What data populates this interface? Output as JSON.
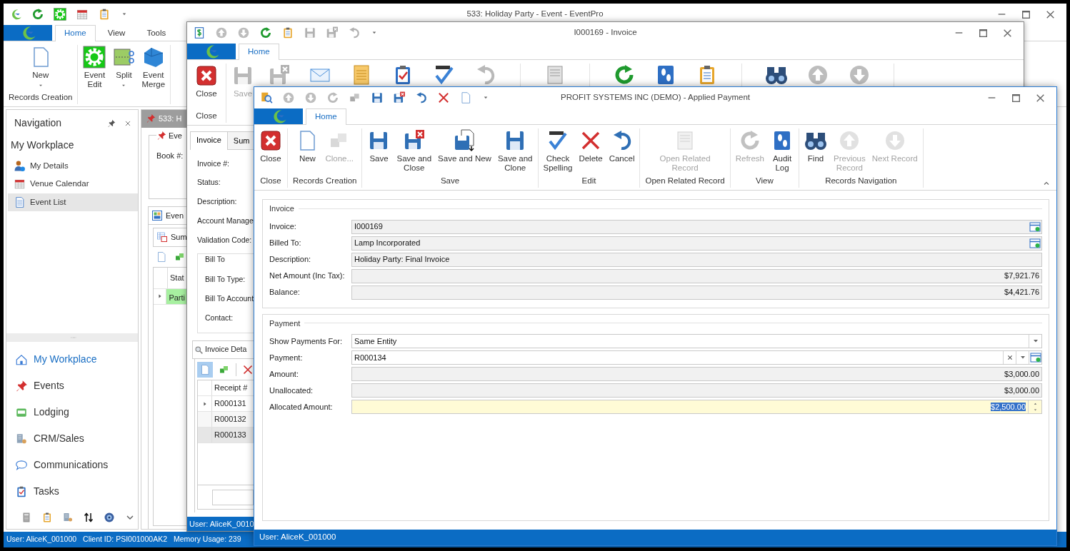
{
  "main_window": {
    "title": "533: Holiday Party - Event - EventPro",
    "tabs": [
      {
        "label": "Home",
        "selected": true
      },
      {
        "label": "View",
        "selected": false
      },
      {
        "label": "Tools",
        "selected": false
      }
    ],
    "ribbon_groups": [
      {
        "label": "Records Creation",
        "buttons": [
          {
            "kind": "new",
            "label": "New",
            "dropdown": true
          }
        ]
      },
      {
        "buttons": [
          {
            "kind": "event-edit",
            "label": "Event\nEdit",
            "dropdown": false
          },
          {
            "kind": "split",
            "label": "Split",
            "dropdown": true
          },
          {
            "kind": "event-merge",
            "label": "Event\nMerge",
            "dropdown": false
          }
        ]
      }
    ],
    "navigation": {
      "title": "Navigation",
      "section": "My Workplace",
      "items": [
        {
          "kind": "details",
          "label": "My Details",
          "selected": false
        },
        {
          "kind": "calendar",
          "label": "Venue Calendar",
          "selected": false
        },
        {
          "kind": "list",
          "label": "Event List",
          "selected": true
        }
      ],
      "modules": [
        {
          "kind": "workplace",
          "label": "My Workplace",
          "selected": true
        },
        {
          "kind": "events",
          "label": "Events",
          "selected": false
        },
        {
          "kind": "lodging",
          "label": "Lodging",
          "selected": false
        },
        {
          "kind": "crm",
          "label": "CRM/Sales",
          "selected": false
        },
        {
          "kind": "communications",
          "label": "Communications",
          "selected": false
        },
        {
          "kind": "tasks",
          "label": "Tasks",
          "selected": false
        }
      ]
    },
    "document": {
      "tab": "533: H",
      "group": "Eve",
      "field_label": "Book #:",
      "section_tab": "Even",
      "sub_tab": "Sum",
      "grid_column": "Stat",
      "grid_rows": [
        {
          "cell": "Parti",
          "current": true
        }
      ]
    },
    "status_bar": [
      "User: AliceK_001000",
      "Client ID: PSI001000AK2",
      "Memory Usage: 239"
    ]
  },
  "invoice_window": {
    "title": "I000169 - Invoice",
    "tabs": [
      {
        "label": "Home",
        "selected": true
      }
    ],
    "ribbon_buttons": [
      {
        "kind": "close",
        "label": "Close",
        "disabled": false
      },
      {
        "kind": "save",
        "label": "Save",
        "disabled": true
      }
    ],
    "ribbon_group": "Close",
    "form_tabs": [
      {
        "label": "Invoice",
        "selected": true
      },
      {
        "label": "Sum",
        "selected": false
      }
    ],
    "labels": [
      "Invoice #:",
      "Status:",
      "Description:",
      "Account Manage",
      "Validation Code:"
    ],
    "bill_to": {
      "title": "Bill To",
      "labels": [
        "Bill To Type:",
        "Bill To Account",
        "Contact:"
      ]
    },
    "details_tab": "Invoice Deta",
    "grid": {
      "column": "Receipt #",
      "rows": [
        {
          "cell": "R000131",
          "current": true,
          "selected": false
        },
        {
          "cell": "R000132",
          "current": false,
          "selected": false
        },
        {
          "cell": "R000133",
          "current": false,
          "selected": true
        }
      ]
    },
    "status_bar": "User: AliceK_0010"
  },
  "payment_window": {
    "title": "PROFIT SYSTEMS INC (DEMO) - Applied Payment",
    "tabs": [
      {
        "label": "Home",
        "selected": true
      }
    ],
    "ribbon_groups": [
      {
        "label": "Close",
        "buttons": [
          {
            "kind": "close",
            "label": "Close",
            "disabled": false
          }
        ]
      },
      {
        "label": "Records Creation",
        "buttons": [
          {
            "kind": "new",
            "label": "New",
            "disabled": false
          },
          {
            "kind": "clone",
            "label": "Clone...",
            "disabled": true
          }
        ]
      },
      {
        "label": "Save",
        "buttons": [
          {
            "kind": "save",
            "label": "Save",
            "disabled": false
          },
          {
            "kind": "save-close",
            "label": "Save and\nClose",
            "disabled": false
          },
          {
            "kind": "save-new",
            "label": "Save and New",
            "disabled": false
          },
          {
            "kind": "save-clone",
            "label": "Save and\nClone",
            "disabled": false
          }
        ]
      },
      {
        "label": "Edit",
        "buttons": [
          {
            "kind": "spellcheck",
            "label": "Check\nSpelling",
            "disabled": false
          },
          {
            "kind": "delete",
            "label": "Delete",
            "disabled": false
          },
          {
            "kind": "cancel",
            "label": "Cancel",
            "disabled": false
          }
        ]
      },
      {
        "label": "Open Related Record",
        "buttons": [
          {
            "kind": "open-related",
            "label": "Open Related\nRecord",
            "disabled": true
          }
        ]
      },
      {
        "label": "View",
        "buttons": [
          {
            "kind": "refresh",
            "label": "Refresh",
            "disabled": true
          },
          {
            "kind": "audit-log",
            "label": "Audit\nLog",
            "disabled": false
          }
        ]
      },
      {
        "label": "Records Navigation",
        "buttons": [
          {
            "kind": "find",
            "label": "Find",
            "disabled": false
          },
          {
            "kind": "previous",
            "label": "Previous\nRecord",
            "disabled": true
          },
          {
            "kind": "next",
            "label": "Next Record",
            "disabled": true
          }
        ]
      }
    ],
    "groups": [
      {
        "title": "Invoice",
        "fields": [
          {
            "kind": "lookup",
            "label": "Invoice:",
            "value": "I000169",
            "focused": false
          },
          {
            "kind": "lookup",
            "label": "Billed To:",
            "value": "Lamp Incorporated",
            "focused": false
          },
          {
            "kind": "text",
            "label": "Description:",
            "value": "Holiday Party: Final Invoice",
            "focused": false
          },
          {
            "kind": "amount",
            "label": "Net Amount (Inc Tax):",
            "value": "$7,921.76",
            "focused": false
          },
          {
            "kind": "amount",
            "label": "Balance:",
            "value": "$4,421.76",
            "focused": false
          }
        ]
      },
      {
        "title": "Payment",
        "fields": [
          {
            "kind": "combo",
            "label": "Show Payments For:",
            "value": "Same Entity",
            "focused": false
          },
          {
            "kind": "combo-lookup",
            "label": "Payment:",
            "value": "R000134",
            "focused": false
          },
          {
            "kind": "amount",
            "label": "Amount:",
            "value": "$3,000.00",
            "focused": false
          },
          {
            "kind": "amount",
            "label": "Unallocated:",
            "value": "$3,000.00",
            "focused": false
          },
          {
            "kind": "spin",
            "label": "Allocated Amount:",
            "value": "$2,500.00",
            "focused": true
          }
        ]
      }
    ],
    "status_bar": "User: AliceK_001000"
  }
}
